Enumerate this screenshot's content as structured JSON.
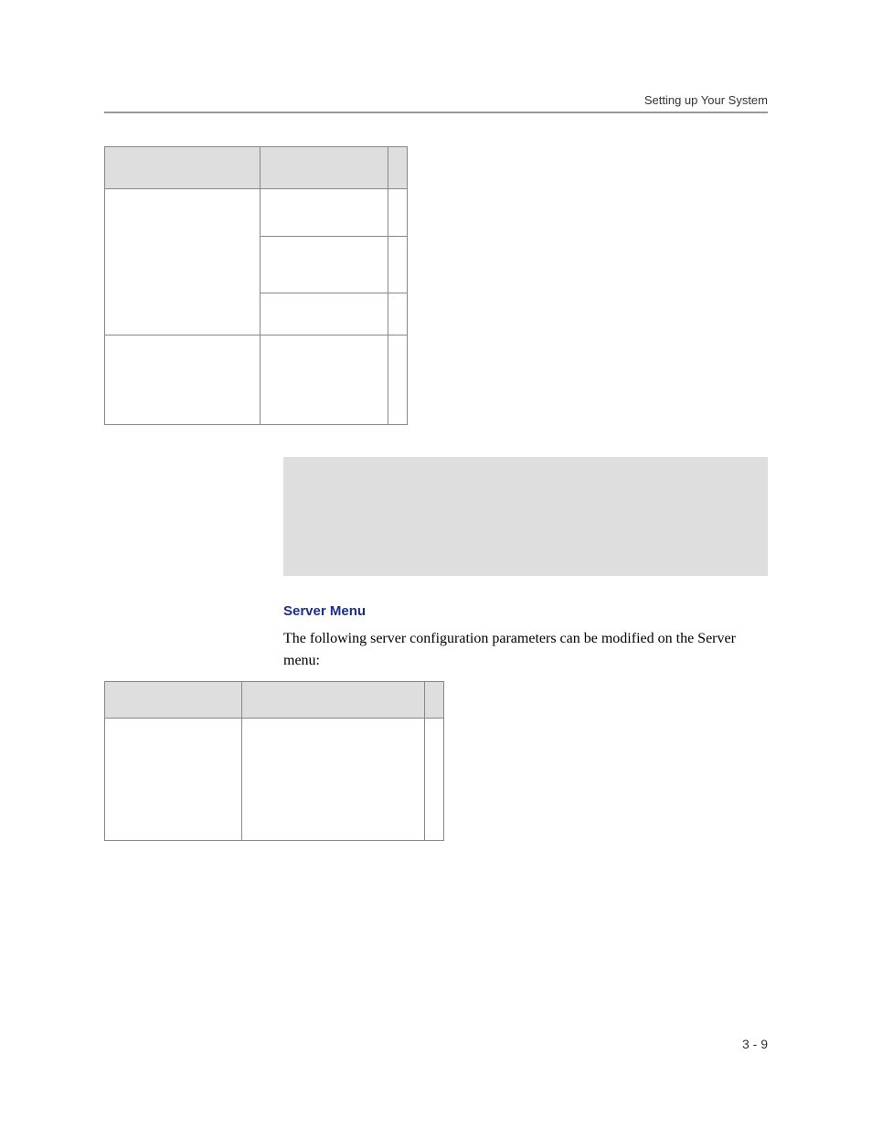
{
  "header": {
    "section_title": "Setting up Your System"
  },
  "table1": {
    "headers": [
      "",
      "",
      ""
    ],
    "rows": [
      [
        "",
        "",
        ""
      ],
      [
        "",
        "",
        ""
      ],
      [
        "",
        "",
        ""
      ],
      [
        "",
        "",
        ""
      ]
    ]
  },
  "server_menu": {
    "heading": "Server Menu",
    "paragraph": "The following server configuration parameters can be modified on the Server menu:"
  },
  "table2": {
    "headers": [
      "",
      "",
      ""
    ],
    "rows": [
      [
        "",
        "",
        ""
      ]
    ]
  },
  "footer": {
    "page_number": "3 - 9"
  }
}
